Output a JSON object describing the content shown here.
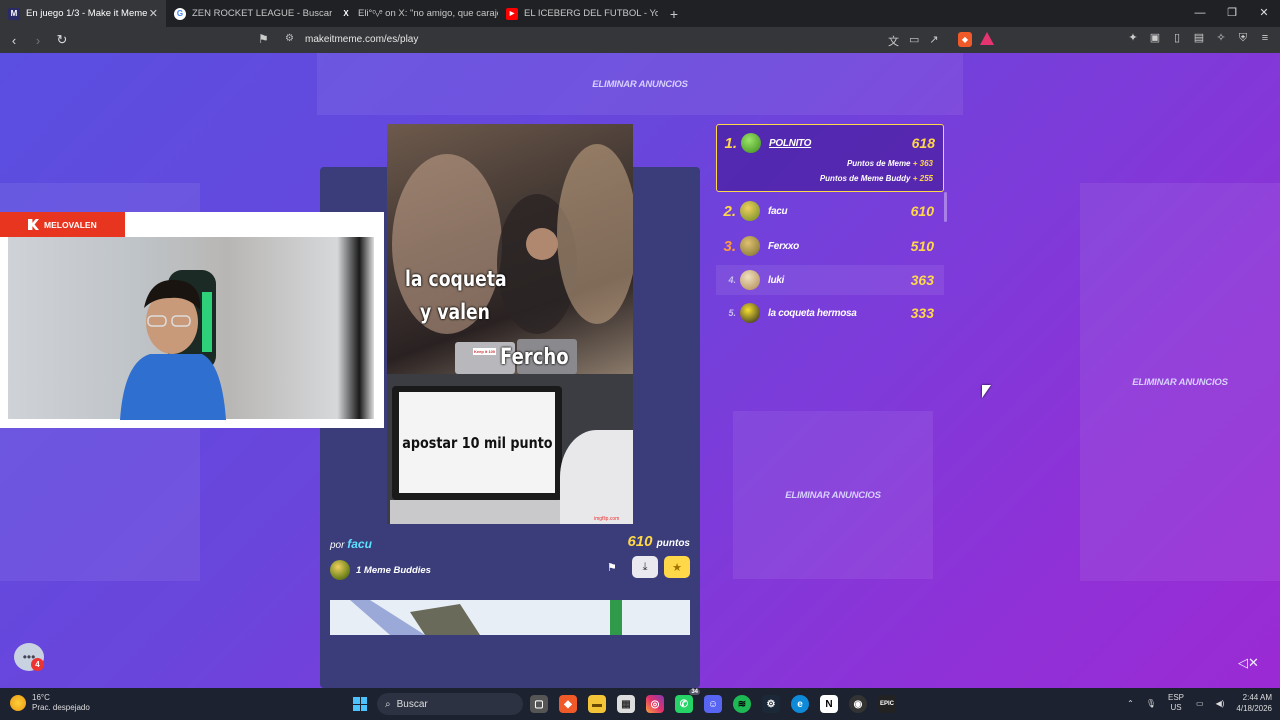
{
  "browser": {
    "tabs": [
      {
        "label": "En juego 1/3 - Make it Meme",
        "icon": "makeitmeme-favicon",
        "active": true
      },
      {
        "label": "ZEN ROCKET LEAGUE - Buscar con G",
        "icon": "google-favicon",
        "active": false
      },
      {
        "label": "Eli°​ᵒᵥᵉ on X: \"no amigo, que carajos",
        "icon": "x-favicon",
        "active": false
      },
      {
        "label": "EL ICEBERG DEL FUTBOL - YouTube",
        "icon": "youtube-favicon",
        "active": false
      }
    ],
    "url": "makeitmeme.com/es/play"
  },
  "ads": {
    "remove_label": "ELIMINAR ANUNCIOS"
  },
  "stream": {
    "streamer": "MELOVALEN"
  },
  "meme": {
    "top_texts": [
      "la coqueta",
      "y valen",
      "Fercho"
    ],
    "bottom_text": "apostar 10 mil punto",
    "laptop_sticker": "Keep it 100",
    "credit": "imgflip.com",
    "by_prefix": "por",
    "author": "facu",
    "score": "610",
    "score_unit": "puntos",
    "buddies": "1 Meme Buddies"
  },
  "leaderboard": {
    "first": {
      "rank": "1.",
      "name": "POLNITO",
      "points": "618",
      "meme_points_label": "Puntos de Meme",
      "meme_points": "+ 363",
      "buddy_points_label": "Puntos de Meme Buddy",
      "buddy_points": "+ 255"
    },
    "rows": [
      {
        "rank": "2.",
        "name": "facu",
        "points": "610"
      },
      {
        "rank": "3.",
        "name": "Ferxxo",
        "points": "510"
      },
      {
        "rank": "4.",
        "name": "luki",
        "points": "363"
      },
      {
        "rank": "5.",
        "name": "la coqueta hermosa",
        "points": "333"
      }
    ]
  },
  "chat": {
    "badge": "4"
  },
  "taskbar": {
    "weather_temp": "16°C",
    "weather_desc": "Prac. despejado",
    "search": "Buscar",
    "whatsapp_badge": "34",
    "lang": "ESP",
    "region": "US",
    "time": "2:44 AM",
    "date": "4/18/2026"
  },
  "colors": {
    "accent": "#ffd84a",
    "author": "#5ee0ff",
    "cam_tag": "#e8351f"
  }
}
